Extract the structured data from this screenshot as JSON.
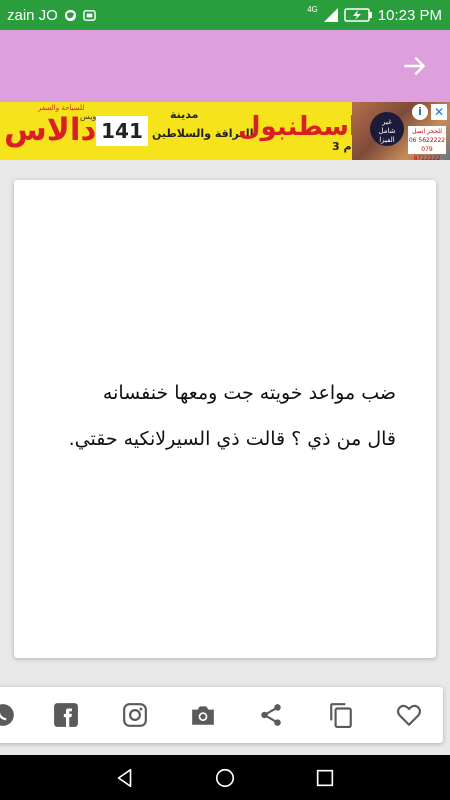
{
  "status_bar": {
    "carrier": "zain JO",
    "network": "4G",
    "time": "10:23 PM"
  },
  "app_bar": {
    "background_color": "#dda0dd",
    "back_icon": "arrow-right-icon"
  },
  "ad": {
    "brand": "دالاس",
    "brand_small": "للسياحة والسفر",
    "brand_sub": "ويس",
    "price": "141",
    "city_label": "مدينة",
    "city_subtitle": "العراقة والسلاطين",
    "destination": "اسطنبول",
    "duration": "3 أيام",
    "badge_line1": "غير",
    "badge_line2": "شامل",
    "badge_line3": "الفيزا",
    "contact_header": "للحجز اتصل",
    "contact_phone1": "06 5622222",
    "contact_phone2": "079 8722222",
    "info_icon": "info-icon",
    "close_icon": "close-icon"
  },
  "post": {
    "line1": "ضب مواعد خويته جت ومعها خنفسانه",
    "line2": "قال من ذي ؟ قالت ذي السيرلانكيه حقتي."
  },
  "share_bar": {
    "icons": [
      "whatsapp-icon",
      "facebook-icon",
      "instagram-icon",
      "camera-icon",
      "share-icon",
      "copy-icon",
      "heart-icon"
    ]
  },
  "nav_bar": {
    "icons": [
      "back-triangle-icon",
      "home-circle-icon",
      "recents-square-icon"
    ]
  }
}
